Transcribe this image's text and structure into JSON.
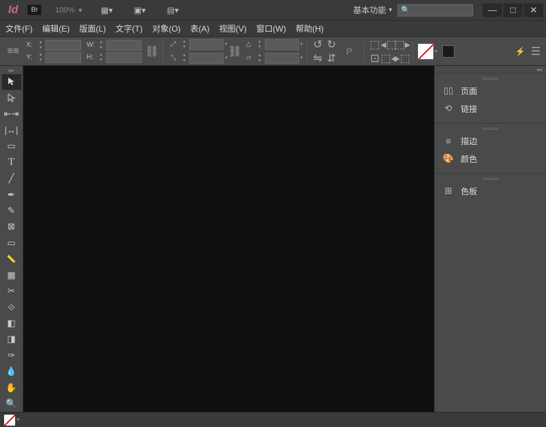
{
  "title": {
    "app_logo": "Id",
    "bridge_badge": "Br",
    "zoom": "100%",
    "workspace": "基本功能"
  },
  "window_controls": {
    "min": "—",
    "max": "□",
    "close": "✕"
  },
  "menu": [
    "文件(F)",
    "编辑(E)",
    "版面(L)",
    "文字(T)",
    "对象(O)",
    "表(A)",
    "视图(V)",
    "窗口(W)",
    "帮助(H)"
  ],
  "controlbar": {
    "x_label": "X:",
    "y_label": "Y:",
    "w_label": "W:",
    "h_label": "H:",
    "p_glyph": "P"
  },
  "panels": {
    "group1": [
      {
        "icon": "pages",
        "label": "页面"
      },
      {
        "icon": "links",
        "label": "链接"
      }
    ],
    "group2": [
      {
        "icon": "stroke",
        "label": "描边"
      },
      {
        "icon": "color",
        "label": "颜色"
      }
    ],
    "group3": [
      {
        "icon": "swatches",
        "label": "色板"
      }
    ]
  }
}
